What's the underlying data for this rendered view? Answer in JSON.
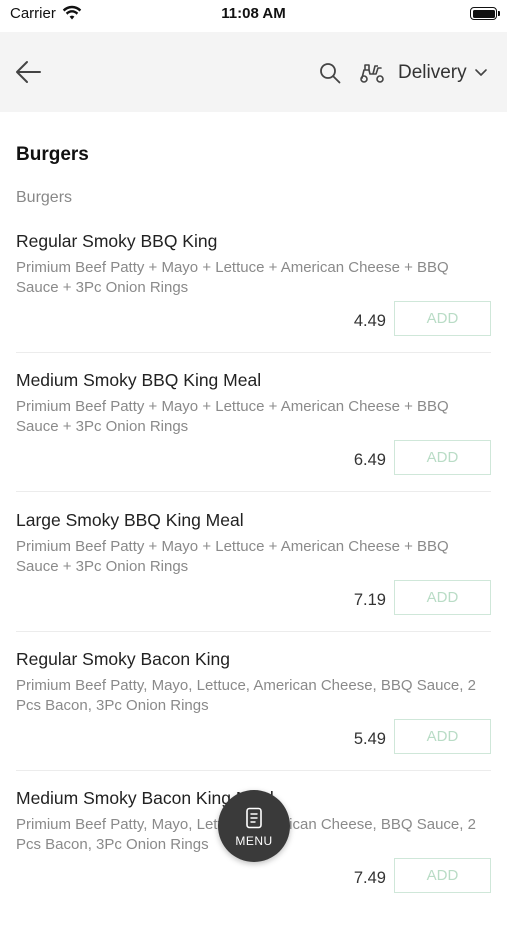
{
  "status_bar": {
    "carrier": "Carrier",
    "time": "11:08 AM"
  },
  "header": {
    "back_icon": "arrow-left",
    "search_icon": "magnifier",
    "delivery_icon": "scooter",
    "delivery_label": "Delivery",
    "dropdown_icon": "chevron-down"
  },
  "menu": {
    "category_title": "Burgers",
    "subcategory": "Burgers",
    "items": [
      {
        "name": "Regular Smoky BBQ King",
        "description": "Primium Beef Patty + Mayo + Lettuce + American Cheese + BBQ Sauce + 3Pc Onion Rings",
        "price": "4.49",
        "add_label": "ADD"
      },
      {
        "name": "Medium Smoky BBQ King Meal",
        "description": "Primium Beef Patty + Mayo + Lettuce + American Cheese + BBQ Sauce + 3Pc Onion Rings",
        "price": "6.49",
        "add_label": "ADD"
      },
      {
        "name": "Large Smoky BBQ King Meal",
        "description": "Primium Beef Patty + Mayo + Lettuce + American Cheese + BBQ Sauce + 3Pc Onion Rings",
        "price": "7.19",
        "add_label": "ADD"
      },
      {
        "name": "Regular Smoky Bacon King",
        "description": "Primium Beef Patty, Mayo, Lettuce, American Cheese,  BBQ Sauce, 2 Pcs Bacon, 3Pc Onion Rings",
        "price": "5.49",
        "add_label": "ADD"
      },
      {
        "name": "Medium Smoky Bacon King Meal",
        "description": "Primium Beef Patty, Mayo, Lettuce, American Cheese,  BBQ Sauce, 2 Pcs Bacon, 3Pc Onion Rings",
        "price": "7.49",
        "add_label": "ADD"
      }
    ]
  },
  "fab": {
    "icon": "menu-card",
    "label": "MENU"
  },
  "colors": {
    "header_bg": "#f4f4f4",
    "add_border": "#cfe7d9",
    "add_text": "#b9dcc6",
    "fab_bg": "#3a3a3a"
  }
}
